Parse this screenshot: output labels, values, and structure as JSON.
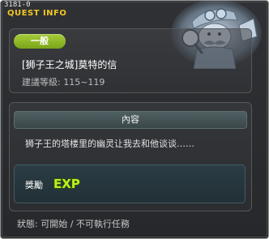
{
  "window": {
    "quest_id": "3181-0",
    "title": "QUEST INFO"
  },
  "header": {
    "npc_icon": "quest-npc-portrait-icon",
    "category": "一般",
    "quest_title": "[狮子王之城]莫特的信",
    "recommended_level": "建議等級: 115~119"
  },
  "content": {
    "header": "內容",
    "text": "狮子王的塔楼里的幽灵让我去和他谈谈……"
  },
  "reward": {
    "label": "獎勵",
    "exp_text": "EXP",
    "exp_icon": "exp-icon"
  },
  "status": {
    "text": "狀態: 可開始 / 不可執行任務"
  },
  "colors": {
    "title": "#f3c623",
    "category_badge": "#8fb82a",
    "exp": "#b8f020"
  }
}
